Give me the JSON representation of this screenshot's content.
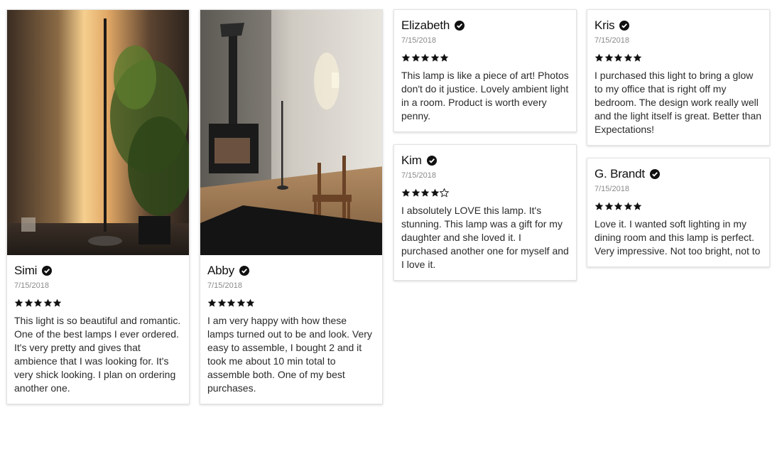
{
  "colors": {
    "star": "#111111",
    "verified": "#111111",
    "date": "#8a8a8a",
    "border": "#e2e2e2"
  },
  "reviews": [
    {
      "name": "Simi",
      "date": "7/15/2018",
      "rating": 5,
      "text": "This light is so beautiful and romantic. One of the best lamps I ever ordered. It's very pretty and gives that ambience that I was looking for. It's very shick looking. I plan on ordering another one.",
      "photo": "floor-lamp-with-bamboo-plant"
    },
    {
      "name": "Abby",
      "date": "7/15/2018",
      "rating": 5,
      "text": "I am very happy with how these lamps turned out to be and look. Very easy to assemble, I bought 2 and it took me about 10 min total to assemble both. One of my best purchases.",
      "photo": "floor-lamp-in-room-with-wood-stove"
    },
    {
      "name": "Elizabeth",
      "date": "7/15/2018",
      "rating": 5,
      "text": "This lamp is like a piece of art! Photos don't do it justice. Lovely ambient light in a room. Product is worth every penny."
    },
    {
      "name": "Kris",
      "date": "7/15/2018",
      "rating": 5,
      "text": "I purchased this light to bring a glow to my office that is right off my bedroom.  The design work really well and the light itself is great. Better than Expectations!"
    },
    {
      "name": "Kim",
      "date": "7/15/2018",
      "rating": 4,
      "text": "I absolutely LOVE this lamp. It's stunning. This lamp was a gift for my daughter and she loved it. I purchased another one for myself and I love it."
    },
    {
      "name": "G. Brandt",
      "date": "7/15/2018",
      "rating": 5,
      "text": "Love it. I wanted soft lighting in my dining room and this lamp is perfect. Very impressive. Not too bright, not to"
    }
  ]
}
